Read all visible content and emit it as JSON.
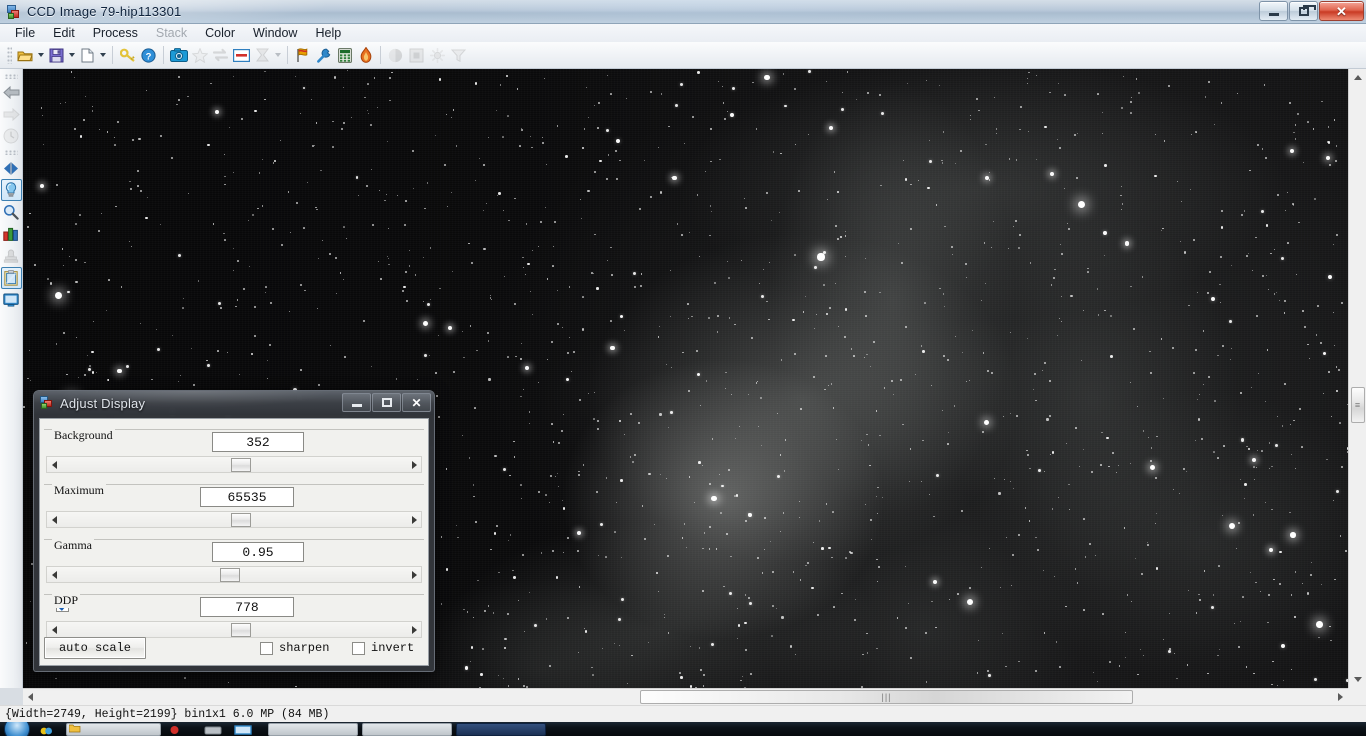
{
  "window": {
    "title": "CCD Image 79-hip113301",
    "icon": "ccd-image-icon",
    "controls": {
      "minimize": "minimize",
      "restore": "restore",
      "close": "close"
    }
  },
  "menubar": {
    "items": [
      {
        "label": "File",
        "disabled": false
      },
      {
        "label": "Edit",
        "disabled": false
      },
      {
        "label": "Process",
        "disabled": false
      },
      {
        "label": "Stack",
        "disabled": true
      },
      {
        "label": "Color",
        "disabled": false
      },
      {
        "label": "Window",
        "disabled": false
      },
      {
        "label": "Help",
        "disabled": false
      }
    ]
  },
  "toolbar": {
    "items": [
      {
        "name": "open-folder-icon",
        "dropdown": true,
        "disabled": false
      },
      {
        "name": "save-icon",
        "dropdown": true,
        "disabled": false
      },
      {
        "name": "new-document-icon",
        "dropdown": true,
        "disabled": false
      },
      {
        "name": "separator"
      },
      {
        "name": "key-icon",
        "dropdown": false,
        "disabled": false
      },
      {
        "name": "help-circle-icon",
        "dropdown": false,
        "disabled": false
      },
      {
        "name": "separator"
      },
      {
        "name": "camera-icon",
        "dropdown": false,
        "disabled": false
      },
      {
        "name": "star-icon",
        "dropdown": false,
        "disabled": true
      },
      {
        "name": "swap-arrows-icon",
        "dropdown": false,
        "disabled": true
      },
      {
        "name": "subtract-box-icon",
        "dropdown": false,
        "disabled": false
      },
      {
        "name": "hourglass-sigma-icon",
        "dropdown": true,
        "disabled": true
      },
      {
        "name": "separator"
      },
      {
        "name": "flag-icon",
        "dropdown": false,
        "disabled": false
      },
      {
        "name": "wrench-icon",
        "dropdown": false,
        "disabled": false
      },
      {
        "name": "calculator-icon",
        "dropdown": false,
        "disabled": false
      },
      {
        "name": "flame-icon",
        "dropdown": false,
        "disabled": false
      },
      {
        "name": "separator"
      },
      {
        "name": "sphere-icon",
        "dropdown": false,
        "disabled": true
      },
      {
        "name": "square-frame-icon",
        "dropdown": false,
        "disabled": true
      },
      {
        "name": "sun-burst-icon",
        "dropdown": false,
        "disabled": true
      },
      {
        "name": "funnel-filter-icon",
        "dropdown": false,
        "disabled": true
      }
    ]
  },
  "left_toolbar": {
    "items": [
      {
        "name": "grip-dots",
        "type": "grip"
      },
      {
        "name": "back-arrow-icon",
        "disabled": false,
        "selected": false
      },
      {
        "name": "forward-arrow-icon",
        "disabled": true,
        "selected": false
      },
      {
        "name": "clock-history-icon",
        "disabled": true,
        "selected": false
      },
      {
        "name": "grip-dots",
        "type": "grip"
      },
      {
        "name": "flip-horizontal-icon",
        "disabled": false,
        "selected": false
      },
      {
        "name": "lightbulb-icon",
        "disabled": false,
        "selected": true
      },
      {
        "name": "magnifier-icon",
        "disabled": false,
        "selected": false
      },
      {
        "name": "bar-chart-icon",
        "disabled": false,
        "selected": false
      },
      {
        "name": "stamp-icon",
        "disabled": true,
        "selected": false
      },
      {
        "name": "clipboard-icon",
        "disabled": false,
        "selected": true
      },
      {
        "name": "monitor-icon",
        "disabled": false,
        "selected": false
      }
    ]
  },
  "image_view": {
    "name": "astronomical-ccd-image",
    "description": "grayscale deep-sky star field with faint nebulosity"
  },
  "scrollbars": {
    "vertical": {
      "up": "scroll-up",
      "down": "scroll-down",
      "thumb_grip": "≡"
    },
    "horizontal": {
      "left": "scroll-left",
      "right": "scroll-right",
      "thumb_grip": "|||"
    }
  },
  "statusbar": {
    "text": "{Width=2749, Height=2199} bin1x1  6.0 MP  (84 MB)"
  },
  "dialog": {
    "title": "Adjust Display",
    "icon": "adjust-display-icon",
    "controls": {
      "minimize": "minimize",
      "maximize": "maximize",
      "close": "close"
    },
    "groups": [
      {
        "legend": "Background",
        "value": "352",
        "slider_pct": 49,
        "has_checkbox": false
      },
      {
        "legend": "Maximum",
        "value": "65535",
        "slider_pct": 49,
        "has_checkbox": false
      },
      {
        "legend": "Gamma",
        "value": "0.95",
        "slider_pct": 46,
        "has_checkbox": false
      },
      {
        "legend": "DDP",
        "value": "778",
        "slider_pct": 49,
        "has_checkbox": true,
        "checked": true
      }
    ],
    "footer": {
      "auto_scale_label": "auto scale",
      "sharpen_label": "sharpen",
      "sharpen_checked": false,
      "invert_label": "invert",
      "invert_checked": false
    }
  },
  "colors": {
    "accent": "#3c7fb1",
    "titlebar": "#b3c4d6",
    "close_button": "#c93a24",
    "dialog_glass": "#3a3e44",
    "dialog_body": "#f1f1ee",
    "image_background": "#0b0b0c"
  }
}
